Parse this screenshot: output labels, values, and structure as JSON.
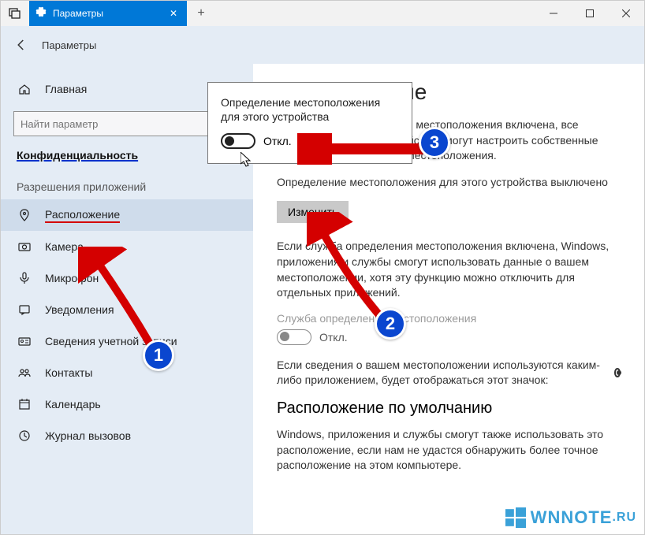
{
  "titlebar": {
    "tab_title": "Параметры"
  },
  "header": {
    "title": "Параметры"
  },
  "sidebar": {
    "search_placeholder": "Найти параметр",
    "home_label": "Главная",
    "privacy_label": "Конфиденциальность",
    "section_label": "Разрешения приложений",
    "items": [
      {
        "label": "Расположение"
      },
      {
        "label": "Камера"
      },
      {
        "label": "Микрофон"
      },
      {
        "label": "Уведомления"
      },
      {
        "label": "Сведения учетной записи"
      },
      {
        "label": "Контакты"
      },
      {
        "label": "Календарь"
      },
      {
        "label": "Журнал вызовов"
      }
    ]
  },
  "main": {
    "heading": "Расположение",
    "intro": "Если служба определения местоположения включена, все пользователи этого устройства смогут настроить собственные параметры определения местоположения.",
    "status": "Определение местоположения для этого устройства выключено",
    "change_btn": "Изменить",
    "desc2": "Если служба определения местоположения включена, Windows, приложения и службы смогут использовать данные о вашем местоположении, хотя эту функцию можно отключить для отдельных приложений.",
    "service_label": "Служба определения местоположения",
    "toggle_off": "Откл.",
    "info_line": "Если сведения о вашем местоположении используются каким-либо приложением, будет отображаться этот значок:",
    "default_heading": "Расположение по умолчанию",
    "default_text": "Windows, приложения и службы смогут также использовать это расположение, если нам не удастся обнаружить более точное расположение на этом компьютере."
  },
  "popup": {
    "title": "Определение местоположения для этого устройства",
    "toggle_label": "Откл."
  },
  "annotations": {
    "badge1": "1",
    "badge2": "2",
    "badge3": "3"
  },
  "watermark": {
    "text1": "W",
    "text2": "NNOTE",
    "text3": ".RU"
  }
}
